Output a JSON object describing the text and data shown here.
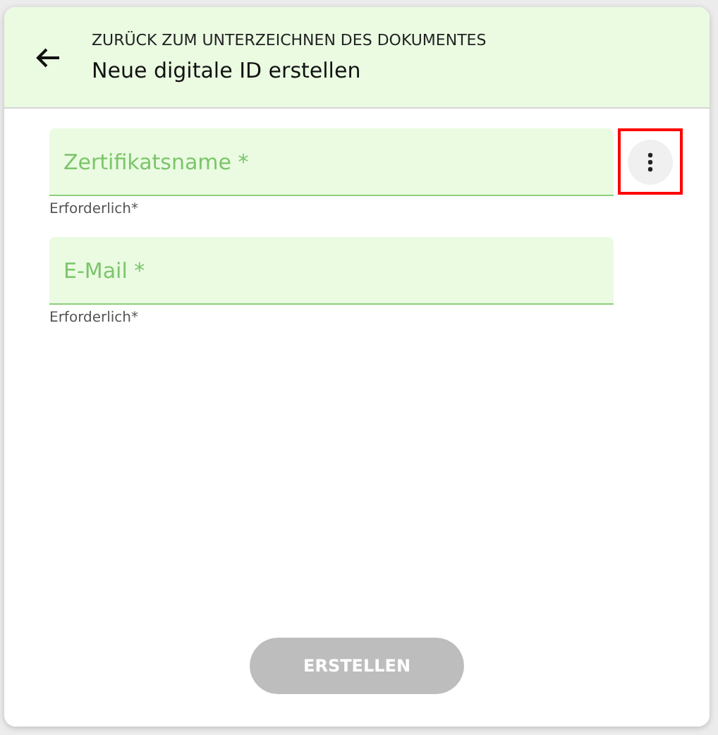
{
  "header": {
    "back_label": "ZURÜCK ZUM UNTERZEICHNEN DES DOKUMENTES",
    "title": "Neue digitale ID erstellen"
  },
  "fields": [
    {
      "placeholder": "Zertifikatsname *",
      "helper": "Erforderlich*",
      "menu": {
        "highlighted": true
      }
    },
    {
      "placeholder": "E-Mail *",
      "helper": "Erforderlich*"
    }
  ],
  "submit": {
    "label": "ERSTELLEN",
    "disabled": true
  }
}
